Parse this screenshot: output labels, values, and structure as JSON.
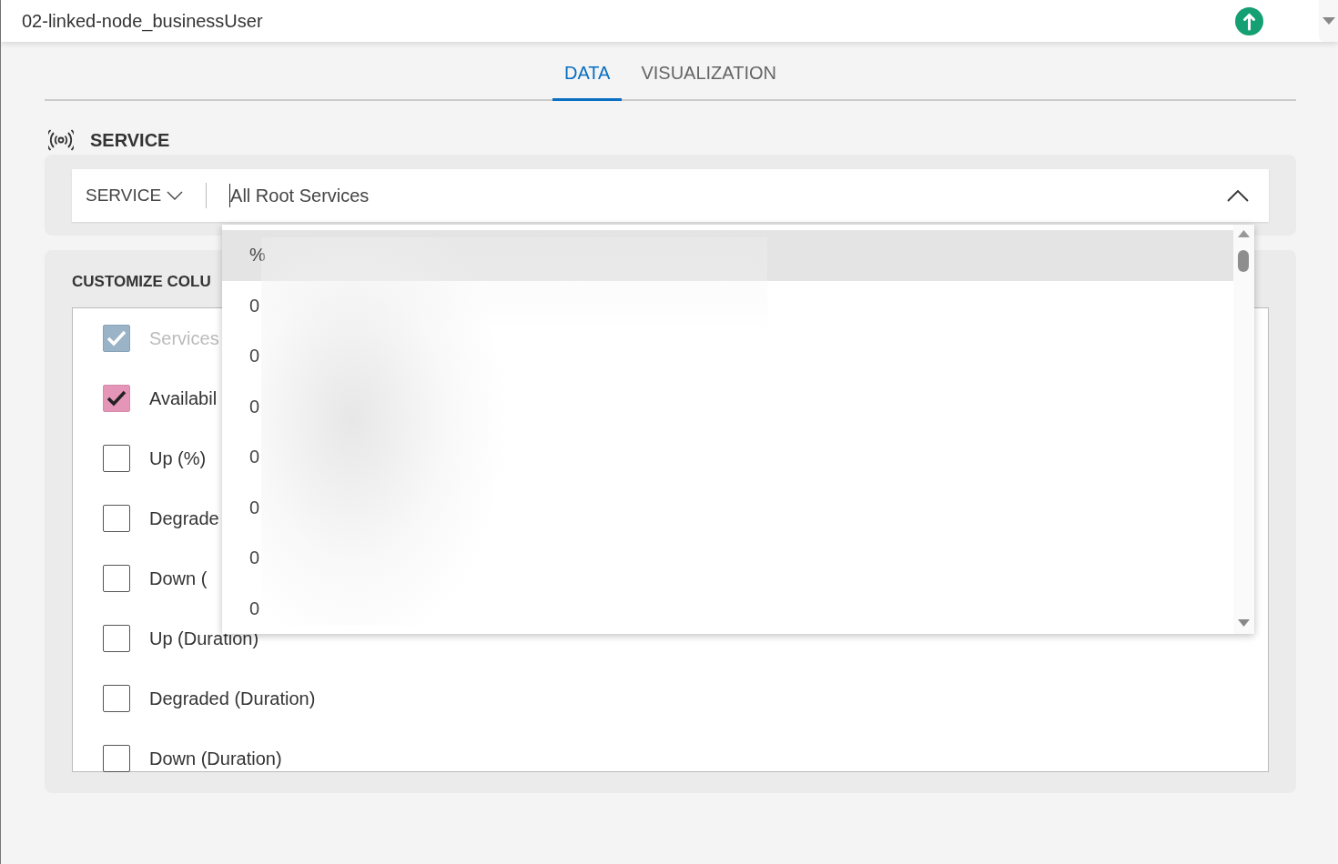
{
  "header": {
    "title": "02-linked-node_businessUser"
  },
  "tabs": [
    {
      "label": "DATA",
      "selected": true
    },
    {
      "label": "VISUALIZATION",
      "selected": false
    }
  ],
  "service": {
    "heading": "SERVICE",
    "selector_label": "SERVICE",
    "value": "All Root Services",
    "expanded": true
  },
  "dropdown": {
    "items": [
      {
        "label": "%",
        "selected": true
      },
      {
        "label": "0",
        "selected": false
      },
      {
        "label": "0",
        "selected": false
      },
      {
        "label": "0",
        "selected": false
      },
      {
        "label": "0",
        "selected": false
      },
      {
        "label": "0",
        "selected": false
      },
      {
        "label": "0",
        "selected": false
      },
      {
        "label": "0",
        "selected": false
      }
    ]
  },
  "columns": {
    "heading": "CUSTOMIZE COLU",
    "items": [
      {
        "label": "Services",
        "checked": true,
        "disabled": true
      },
      {
        "label": "Availabil",
        "checked": true,
        "disabled": false
      },
      {
        "label": "Up (%)",
        "checked": false,
        "disabled": false
      },
      {
        "label": "Degrade",
        "checked": false,
        "disabled": false
      },
      {
        "label": "Down (",
        "checked": false,
        "disabled": false
      },
      {
        "label": "Up (Duration)",
        "checked": false,
        "disabled": false
      },
      {
        "label": "Degraded (Duration)",
        "checked": false,
        "disabled": false
      },
      {
        "label": "Down (Duration)",
        "checked": false,
        "disabled": false
      }
    ]
  }
}
